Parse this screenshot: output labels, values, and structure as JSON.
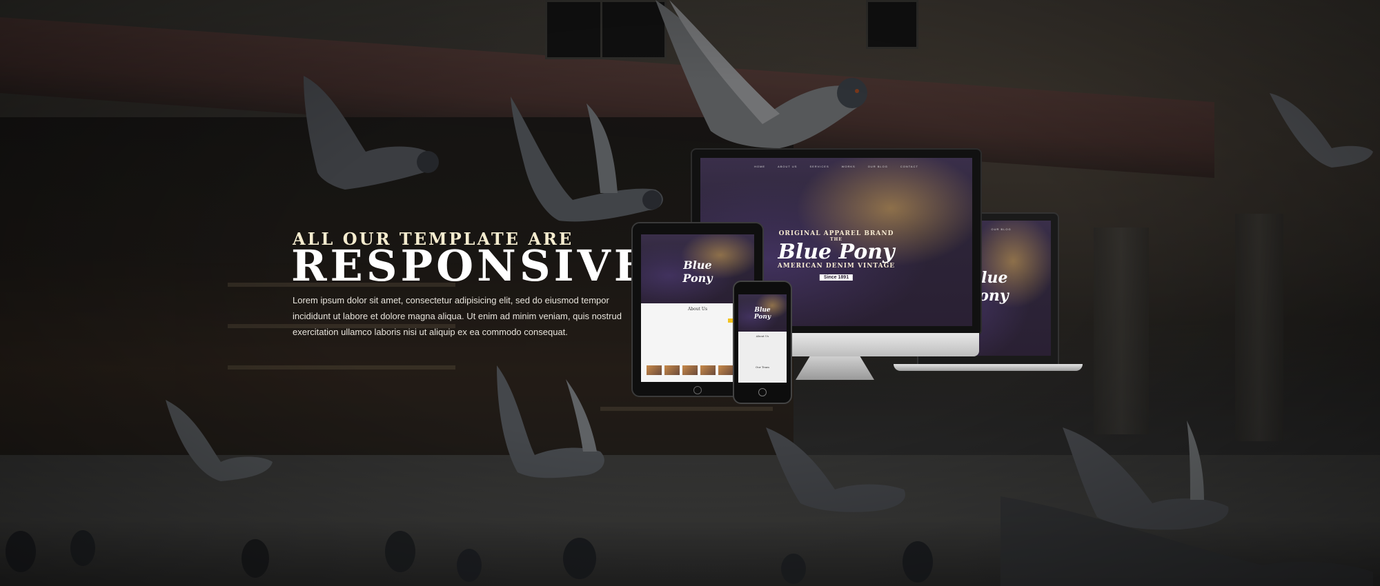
{
  "hero": {
    "subtitle": "ALL OUR TEMPLATE ARE",
    "title": "RESPONSIVE",
    "description": "Lorem ipsum dolor sit amet, consectetur adipisicing elit, sed do eiusmod tempor incididunt ut labore et dolore magna aliqua. Ut enim ad minim veniam, quis nostrud exercitation ullamco laboris nisi ut aliquip ex ea commodo consequat."
  },
  "mockup_site": {
    "nav": [
      "HOME",
      "ABOUT US",
      "SERVICES",
      "WORKS",
      "OUR BLOG",
      "CONTACT"
    ],
    "brand_top": "ORIGINAL APPAREL BRAND",
    "brand_the": "THE",
    "brand_name": "Blue Pony",
    "brand_sub": "AMERICAN DENIM VINTAGE",
    "brand_since": "Since 1891",
    "about_heading": "About Us",
    "team_heading": "Our Team"
  },
  "colors": {
    "accent": "#f2c320",
    "text_light": "#f5eccf"
  }
}
